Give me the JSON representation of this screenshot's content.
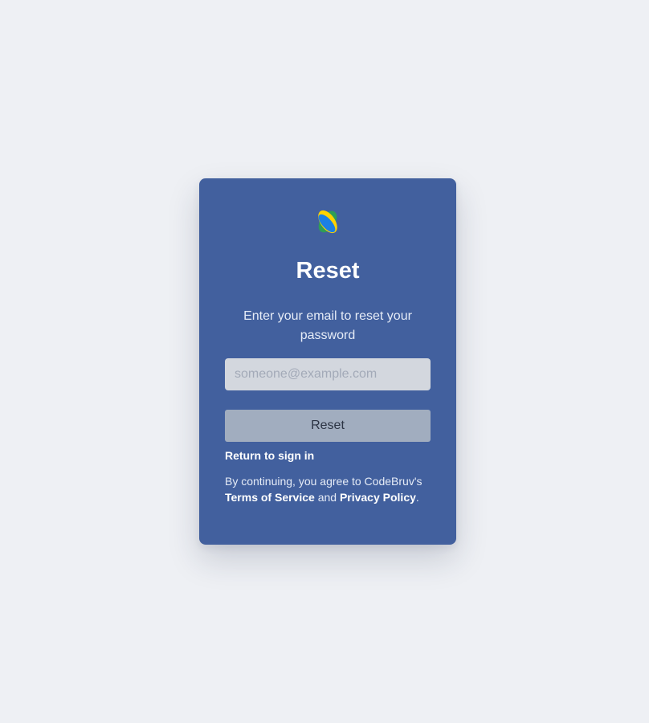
{
  "app": {
    "logo_icon": "codebruv-logo-icon",
    "logo_colors": {
      "green": "#2e9e57",
      "yellow": "#ffd200",
      "blue": "#1b7fe3"
    }
  },
  "card": {
    "background": "#42609e",
    "title": "Reset",
    "subtitle": "Enter your email to reset your password"
  },
  "form": {
    "email_value": "",
    "email_placeholder": "someone@example.com",
    "submit_label": "Reset",
    "return_label": "Return to sign in"
  },
  "legal": {
    "prefix": "By continuing, you agree to CodeBruv's",
    "terms_label": "Terms of Service",
    "conjunction": "and",
    "privacy_label": "Privacy Policy",
    "suffix": "."
  }
}
